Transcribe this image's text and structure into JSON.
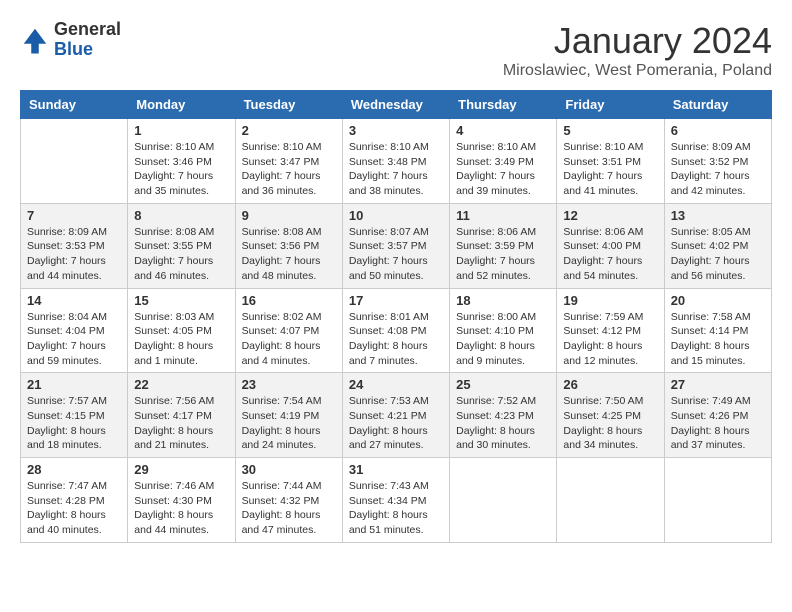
{
  "header": {
    "logo_general": "General",
    "logo_blue": "Blue",
    "month_title": "January 2024",
    "location": "Miroslawiec, West Pomerania, Poland"
  },
  "weekdays": [
    "Sunday",
    "Monday",
    "Tuesday",
    "Wednesday",
    "Thursday",
    "Friday",
    "Saturday"
  ],
  "weeks": [
    [
      {
        "day": "",
        "info": ""
      },
      {
        "day": "1",
        "info": "Sunrise: 8:10 AM\nSunset: 3:46 PM\nDaylight: 7 hours\nand 35 minutes."
      },
      {
        "day": "2",
        "info": "Sunrise: 8:10 AM\nSunset: 3:47 PM\nDaylight: 7 hours\nand 36 minutes."
      },
      {
        "day": "3",
        "info": "Sunrise: 8:10 AM\nSunset: 3:48 PM\nDaylight: 7 hours\nand 38 minutes."
      },
      {
        "day": "4",
        "info": "Sunrise: 8:10 AM\nSunset: 3:49 PM\nDaylight: 7 hours\nand 39 minutes."
      },
      {
        "day": "5",
        "info": "Sunrise: 8:10 AM\nSunset: 3:51 PM\nDaylight: 7 hours\nand 41 minutes."
      },
      {
        "day": "6",
        "info": "Sunrise: 8:09 AM\nSunset: 3:52 PM\nDaylight: 7 hours\nand 42 minutes."
      }
    ],
    [
      {
        "day": "7",
        "info": "Sunrise: 8:09 AM\nSunset: 3:53 PM\nDaylight: 7 hours\nand 44 minutes."
      },
      {
        "day": "8",
        "info": "Sunrise: 8:08 AM\nSunset: 3:55 PM\nDaylight: 7 hours\nand 46 minutes."
      },
      {
        "day": "9",
        "info": "Sunrise: 8:08 AM\nSunset: 3:56 PM\nDaylight: 7 hours\nand 48 minutes."
      },
      {
        "day": "10",
        "info": "Sunrise: 8:07 AM\nSunset: 3:57 PM\nDaylight: 7 hours\nand 50 minutes."
      },
      {
        "day": "11",
        "info": "Sunrise: 8:06 AM\nSunset: 3:59 PM\nDaylight: 7 hours\nand 52 minutes."
      },
      {
        "day": "12",
        "info": "Sunrise: 8:06 AM\nSunset: 4:00 PM\nDaylight: 7 hours\nand 54 minutes."
      },
      {
        "day": "13",
        "info": "Sunrise: 8:05 AM\nSunset: 4:02 PM\nDaylight: 7 hours\nand 56 minutes."
      }
    ],
    [
      {
        "day": "14",
        "info": "Sunrise: 8:04 AM\nSunset: 4:04 PM\nDaylight: 7 hours\nand 59 minutes."
      },
      {
        "day": "15",
        "info": "Sunrise: 8:03 AM\nSunset: 4:05 PM\nDaylight: 8 hours\nand 1 minute."
      },
      {
        "day": "16",
        "info": "Sunrise: 8:02 AM\nSunset: 4:07 PM\nDaylight: 8 hours\nand 4 minutes."
      },
      {
        "day": "17",
        "info": "Sunrise: 8:01 AM\nSunset: 4:08 PM\nDaylight: 8 hours\nand 7 minutes."
      },
      {
        "day": "18",
        "info": "Sunrise: 8:00 AM\nSunset: 4:10 PM\nDaylight: 8 hours\nand 9 minutes."
      },
      {
        "day": "19",
        "info": "Sunrise: 7:59 AM\nSunset: 4:12 PM\nDaylight: 8 hours\nand 12 minutes."
      },
      {
        "day": "20",
        "info": "Sunrise: 7:58 AM\nSunset: 4:14 PM\nDaylight: 8 hours\nand 15 minutes."
      }
    ],
    [
      {
        "day": "21",
        "info": "Sunrise: 7:57 AM\nSunset: 4:15 PM\nDaylight: 8 hours\nand 18 minutes."
      },
      {
        "day": "22",
        "info": "Sunrise: 7:56 AM\nSunset: 4:17 PM\nDaylight: 8 hours\nand 21 minutes."
      },
      {
        "day": "23",
        "info": "Sunrise: 7:54 AM\nSunset: 4:19 PM\nDaylight: 8 hours\nand 24 minutes."
      },
      {
        "day": "24",
        "info": "Sunrise: 7:53 AM\nSunset: 4:21 PM\nDaylight: 8 hours\nand 27 minutes."
      },
      {
        "day": "25",
        "info": "Sunrise: 7:52 AM\nSunset: 4:23 PM\nDaylight: 8 hours\nand 30 minutes."
      },
      {
        "day": "26",
        "info": "Sunrise: 7:50 AM\nSunset: 4:25 PM\nDaylight: 8 hours\nand 34 minutes."
      },
      {
        "day": "27",
        "info": "Sunrise: 7:49 AM\nSunset: 4:26 PM\nDaylight: 8 hours\nand 37 minutes."
      }
    ],
    [
      {
        "day": "28",
        "info": "Sunrise: 7:47 AM\nSunset: 4:28 PM\nDaylight: 8 hours\nand 40 minutes."
      },
      {
        "day": "29",
        "info": "Sunrise: 7:46 AM\nSunset: 4:30 PM\nDaylight: 8 hours\nand 44 minutes."
      },
      {
        "day": "30",
        "info": "Sunrise: 7:44 AM\nSunset: 4:32 PM\nDaylight: 8 hours\nand 47 minutes."
      },
      {
        "day": "31",
        "info": "Sunrise: 7:43 AM\nSunset: 4:34 PM\nDaylight: 8 hours\nand 51 minutes."
      },
      {
        "day": "",
        "info": ""
      },
      {
        "day": "",
        "info": ""
      },
      {
        "day": "",
        "info": ""
      }
    ]
  ]
}
